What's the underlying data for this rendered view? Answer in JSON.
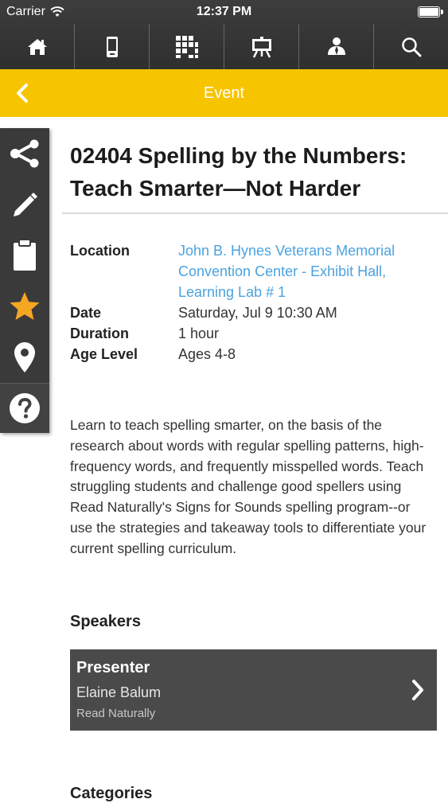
{
  "status_bar": {
    "carrier": "Carrier",
    "time": "12:37 PM",
    "battery_level": 1.0
  },
  "toolbar": {
    "items": [
      {
        "icon": "home-icon"
      },
      {
        "icon": "mobile-device-icon"
      },
      {
        "icon": "grid-icon"
      },
      {
        "icon": "presentation-board-icon"
      },
      {
        "icon": "person-icon"
      },
      {
        "icon": "search-icon"
      }
    ]
  },
  "titlebar": {
    "title": "Event",
    "back_icon": "chevron-left-icon"
  },
  "sidebar": {
    "items": [
      {
        "icon": "share-icon"
      },
      {
        "icon": "pencil-icon"
      },
      {
        "icon": "clipboard-icon"
      },
      {
        "icon": "star-icon"
      },
      {
        "icon": "map-pin-icon"
      },
      {
        "icon": "help-icon"
      }
    ]
  },
  "event": {
    "title": "02404 Spelling by the Numbers: Teach Smarter—Not Harder",
    "location_label": "Location",
    "location_value": "John B. Hynes Veterans Memorial Convention Center - Exhibit Hall, Learning Lab # 1",
    "date_label": "Date",
    "date_value": "Saturday, Jul 9 10:30 AM",
    "duration_label": "Duration",
    "duration_value": "1 hour",
    "age_label": "Age Level",
    "age_value": "Ages 4-8",
    "description": "Learn to teach spelling smarter, on the basis of the research about words with regular spelling patterns, high-frequency words, and frequently misspelled words. Teach struggling students and challenge good spellers using Read Naturally's Signs for Sounds spelling program--or use the strategies and takeaway tools to differentiate your current spelling curriculum."
  },
  "speakers": {
    "heading": "Speakers",
    "items": [
      {
        "role": "Presenter",
        "name": "Elaine Balum",
        "organization": "Read Naturally"
      }
    ]
  },
  "categories": {
    "heading": "Categories"
  },
  "colors": {
    "toolbar_bg": "#333333",
    "accent_yellow": "#f7c400",
    "link_blue": "#4aa3df",
    "star_orange": "#f5a623",
    "card_bg": "#4a4a4a"
  }
}
